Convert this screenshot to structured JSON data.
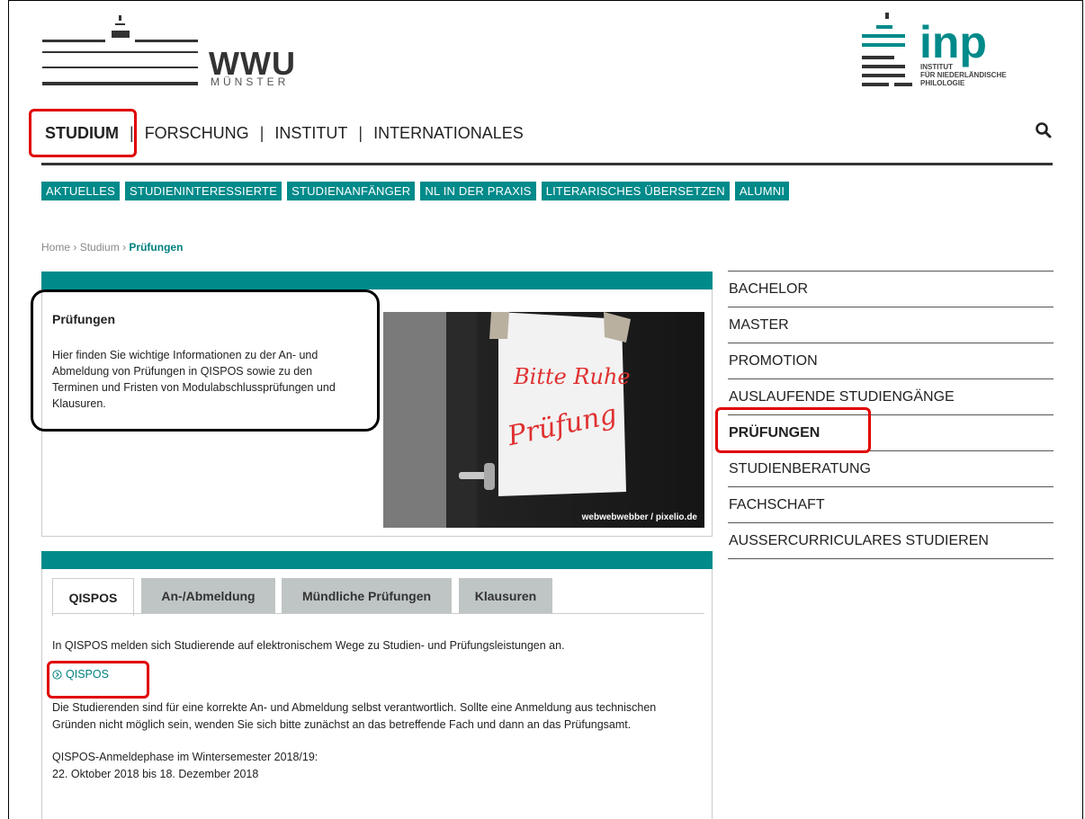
{
  "brand": {
    "wwu_name": "WWU",
    "wwu_city": "MÜNSTER",
    "inp_name": "inp",
    "inp_line1": "INSTITUT",
    "inp_line2": "FÜR NIEDERLÄNDISCHE",
    "inp_line3": "PHILOLOGIE"
  },
  "main_nav": {
    "items": [
      "STUDIUM",
      "FORSCHUNG",
      "INSTITUT",
      "INTERNATIONALES"
    ],
    "active": "STUDIUM",
    "search_icon": "search-icon"
  },
  "sub_nav": {
    "items": [
      "AKTUELLES",
      "STUDIENINTERESSIERTE",
      "STUDIENANFÄNGER",
      "NL IN DER PRAXIS",
      "LITERARISCHES ÜBERSETZEN",
      "ALUMNI"
    ]
  },
  "breadcrumb": {
    "items": [
      "Home",
      "Studium",
      "Prüfungen"
    ],
    "separator": "›"
  },
  "hero": {
    "title": "Prüfungen",
    "text": "Hier finden Sie wichtige Informationen zu der An- und Abmeldung von Prüfungen in QISPOS sowie zu den Terminen und Fristen von Modulabschlussprüfungen und Klausuren.",
    "photo_sign_line1": "Bitte Ruhe",
    "photo_sign_line2": "Prüfung",
    "photo_credit": "webwebwebber / pixelio.de"
  },
  "tabs": {
    "items": [
      "QISPOS",
      "An-/Abmeldung",
      "Mündliche Prüfungen",
      "Klausuren"
    ],
    "active": "QISPOS"
  },
  "tab_content": {
    "intro": "In QISPOS melden sich Studierende auf elektronischem Wege zu Studien- und Prüfungsleistungen an.",
    "link_label": "QISPOS",
    "paragraph": "Die Studierenden sind für eine korrekte An- und Abmeldung selbst verantwortlich. Sollte eine Anmeldung aus technischen Gründen nicht möglich sein, wenden Sie sich bitte zunächst an das betreffende Fach und dann an das Prüfungsamt.",
    "phase_label": "QISPOS-Anmeldephase im Wintersemester 2018/19:",
    "phase_dates": "22. Oktober 2018 bis 18. Dezember 2018"
  },
  "sidebar": {
    "items": [
      "BACHELOR",
      "MASTER",
      "PROMOTION",
      "AUSLAUFENDE STUDIENGÄNGE",
      "PRÜFUNGEN",
      "STUDIENBERATUNG",
      "FACHSCHAFT",
      "AUSSERCURRICULARES STUDIEREN"
    ],
    "active": "PRÜFUNGEN"
  },
  "colors": {
    "teal": "#008a8a",
    "highlight_red": "#e00000"
  }
}
